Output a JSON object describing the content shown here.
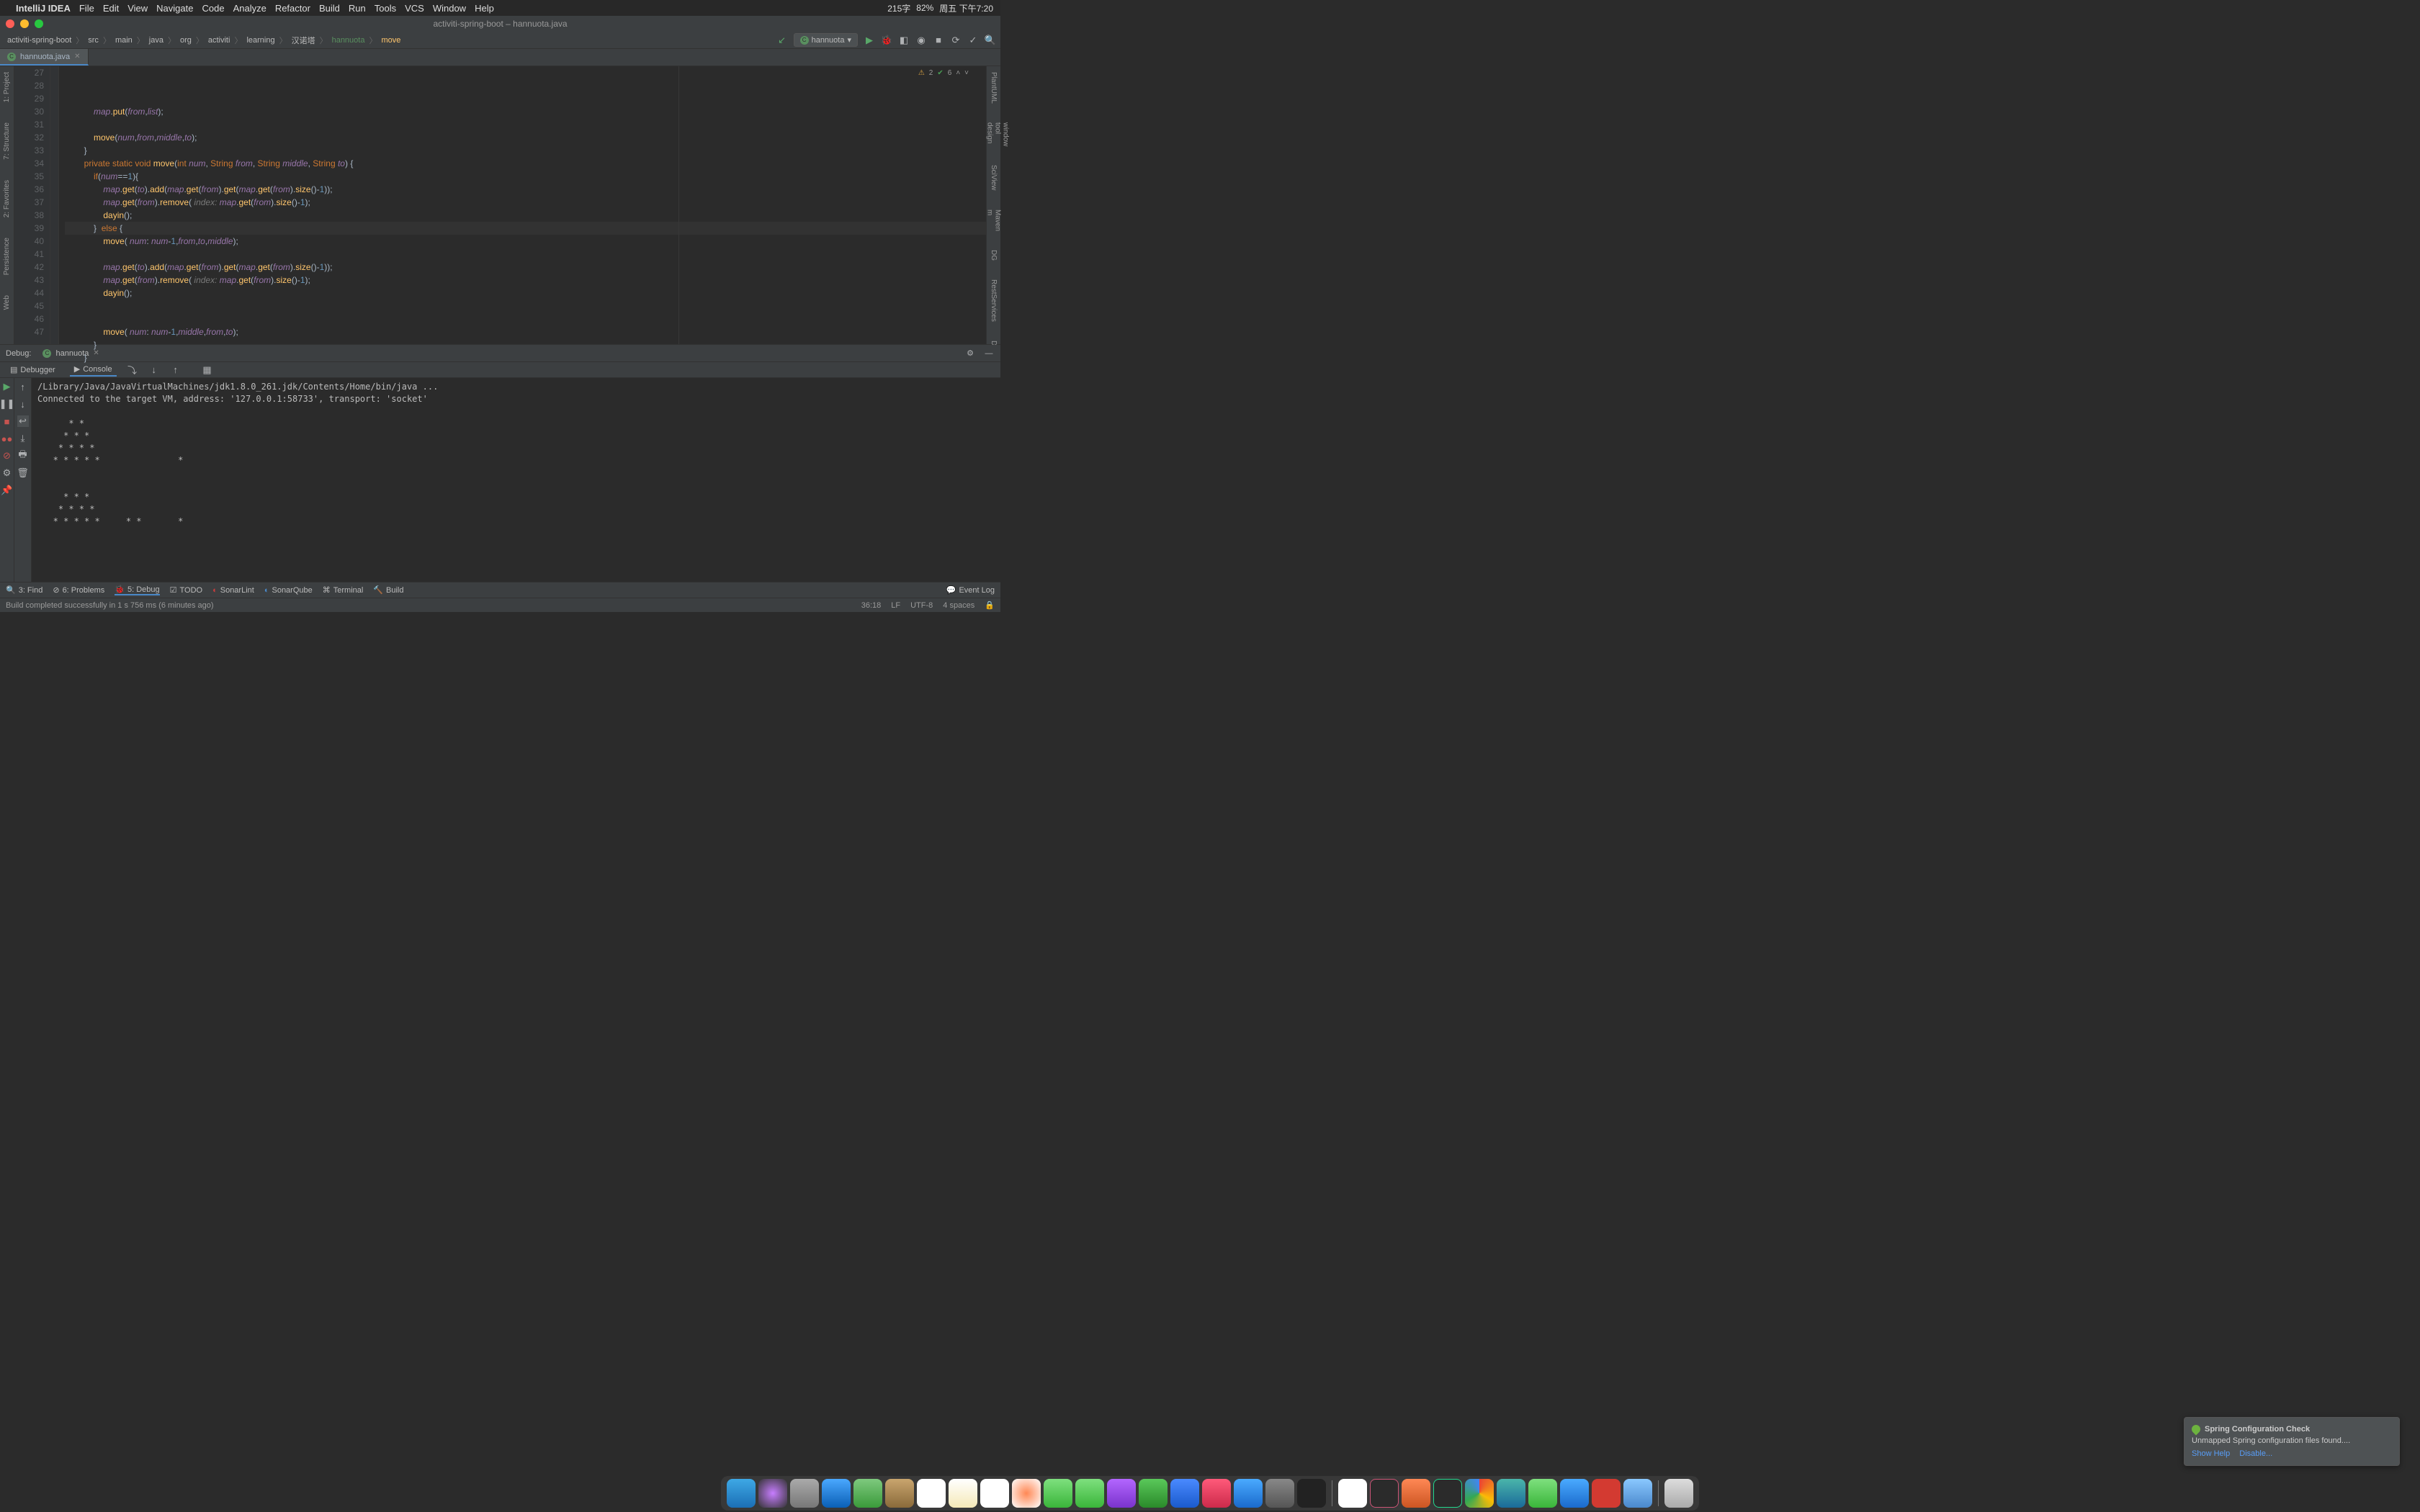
{
  "macMenu": {
    "appName": "IntelliJ IDEA",
    "items": [
      "File",
      "Edit",
      "View",
      "Navigate",
      "Code",
      "Analyze",
      "Refactor",
      "Build",
      "Run",
      "Tools",
      "VCS",
      "Window",
      "Help"
    ],
    "statusRight": [
      "215字",
      "82%",
      "周五 下午7:20"
    ]
  },
  "window": {
    "title": "activiti-spring-boot – hannuota.java"
  },
  "breadcrumb": [
    "activiti-spring-boot",
    "src",
    "main",
    "java",
    "org",
    "activiti",
    "learning",
    "汉诺塔",
    "hannuota",
    "move"
  ],
  "runConfig": "hannuota",
  "tabs": [
    {
      "name": "hannuota.java"
    }
  ],
  "inspections": {
    "warnings": "2",
    "ok": "6"
  },
  "gutterStart": 27,
  "codeLines": [
    {
      "n": 27,
      "txt": "            map.put(from,list);"
    },
    {
      "n": 28,
      "txt": ""
    },
    {
      "n": 29,
      "txt": "            move(num,from,middle,to);"
    },
    {
      "n": 30,
      "txt": "        }"
    },
    {
      "n": 31,
      "txt": "        private static void move(int num, String from, String middle, String to) {"
    },
    {
      "n": 32,
      "txt": "            if(num==1){"
    },
    {
      "n": 33,
      "txt": "                map.get(to).add(map.get(from).get(map.get(from).size()-1));"
    },
    {
      "n": 34,
      "txt": "                map.get(from).remove( index: map.get(from).size()-1);"
    },
    {
      "n": 35,
      "txt": "                dayin();"
    },
    {
      "n": 36,
      "txt": "            }  else {",
      "hl": true
    },
    {
      "n": 37,
      "txt": "                move( num: num-1,from,to,middle);"
    },
    {
      "n": 38,
      "txt": ""
    },
    {
      "n": 39,
      "txt": "                map.get(to).add(map.get(from).get(map.get(from).size()-1));"
    },
    {
      "n": 40,
      "txt": "                map.get(from).remove( index: map.get(from).size()-1);"
    },
    {
      "n": 41,
      "txt": "                dayin();"
    },
    {
      "n": 42,
      "txt": ""
    },
    {
      "n": 43,
      "txt": ""
    },
    {
      "n": 44,
      "txt": "                move( num: num-1,middle,from,to);"
    },
    {
      "n": 45,
      "txt": "            }"
    },
    {
      "n": 46,
      "txt": "        }"
    },
    {
      "n": 47,
      "txt": ""
    }
  ],
  "debug": {
    "label": "Debug:",
    "configTab": "hannuota",
    "subtabs": [
      "Debugger",
      "Console"
    ],
    "consoleLines": [
      "/Library/Java/JavaVirtualMachines/jdk1.8.0_261.jdk/Contents/Home/bin/java ...",
      "Connected to the target VM, address: '127.0.0.1:58733', transport: 'socket'",
      "",
      "      * *",
      "     * * *",
      "    * * * *",
      "   * * * * *               *",
      "",
      "",
      "     * * *",
      "    * * * *",
      "   * * * * *     * *       *",
      ""
    ]
  },
  "bottomTools": [
    "3: Find",
    "6: Problems",
    "5: Debug",
    "TODO",
    "SonarLint",
    "SonarQube",
    "Terminal",
    "Build"
  ],
  "eventLog": "Event Log",
  "statusBar": {
    "message": "Build completed successfully in 1 s 756 ms (6 minutes ago)",
    "caret": "36:18",
    "lineEnd": "LF",
    "encoding": "UTF-8",
    "indent": "4 spaces"
  },
  "notification": {
    "title": "Spring Configuration Check",
    "body": "Unmapped Spring configuration files found....",
    "actions": [
      "Show Help",
      "Disable..."
    ]
  },
  "leftStripe": [
    "1: Project",
    "7: Structure",
    "2: Favorites",
    "Persistence",
    "Web"
  ],
  "rightStripe": [
    "PlantUML",
    "UML design tool window",
    "SciView",
    "m Maven",
    "DG",
    "RestServices",
    "Database"
  ]
}
